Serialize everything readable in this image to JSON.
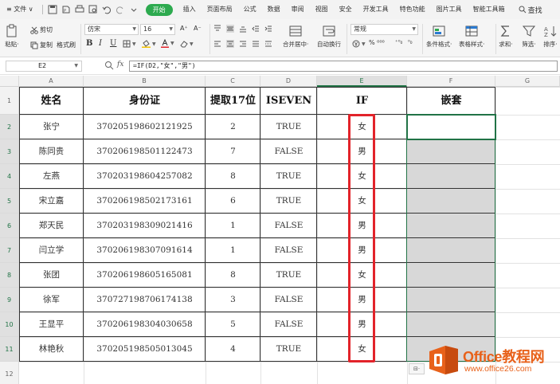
{
  "menubar": {
    "file_label": "≡ 文件 ∨",
    "tabs": [
      "插入",
      "页面布局",
      "公式",
      "数据",
      "审阅",
      "视图",
      "安全",
      "开发工具",
      "特色功能",
      "图片工具",
      "智能工具箱"
    ],
    "active_tab": "开始",
    "search_label": "查找"
  },
  "ribbon": {
    "paste_label": "粘贴·",
    "cut_label": "剪切",
    "copy_label": "复制",
    "format_painter_label": "格式刷",
    "font_name": "仿宋",
    "font_size": "16",
    "font_grow": "A⁺",
    "font_shrink": "A⁻",
    "bold": "B",
    "italic": "I",
    "underline": "U",
    "merge_center_label": "合并居中·",
    "wrap_text_label": "自动换行",
    "number_format": "常规",
    "percent_label": "% ⁰⁰⁰",
    "decimal_inc": "⁺⁰₀",
    "decimal_dec": "⁰₀",
    "cond_format_label": "条件格式·",
    "table_style_label": "表格样式·",
    "sum_label": "求和·",
    "filter_label": "筛选·",
    "sort_label": "排序·"
  },
  "formula_bar": {
    "cell_ref": "E2",
    "fx_label": "fx",
    "formula": "=IF(D2,\"女\",\"男\")"
  },
  "sheet": {
    "columns": [
      "A",
      "B",
      "C",
      "D",
      "E",
      "F",
      "G"
    ],
    "selected_column": "E",
    "row_numbers": [
      "1",
      "2",
      "3",
      "4",
      "5",
      "6",
      "7",
      "8",
      "9",
      "10",
      "11",
      "12"
    ],
    "headers": [
      "姓名",
      "身份证",
      "提取17位",
      "ISEVEN",
      "IF",
      "嵌套"
    ],
    "rows": [
      [
        "张宁",
        "370205198602121925",
        "2",
        "TRUE",
        "女",
        ""
      ],
      [
        "陈同贵",
        "370206198501122473",
        "7",
        "FALSE",
        "男",
        ""
      ],
      [
        "左燕",
        "370203198604257082",
        "8",
        "TRUE",
        "女",
        ""
      ],
      [
        "宋立嘉",
        "370206198502173161",
        "6",
        "TRUE",
        "女",
        ""
      ],
      [
        "郑天民",
        "370203198309021416",
        "1",
        "FALSE",
        "男",
        ""
      ],
      [
        "闫立学",
        "370206198307091614",
        "1",
        "FALSE",
        "男",
        ""
      ],
      [
        "张团",
        "370206198605165081",
        "8",
        "TRUE",
        "女",
        ""
      ],
      [
        "徐军",
        "370727198706174138",
        "3",
        "FALSE",
        "男",
        ""
      ],
      [
        "王显平",
        "370206198304030658",
        "5",
        "FALSE",
        "男",
        ""
      ],
      [
        "林艳秋",
        "370205198505013045",
        "4",
        "TRUE",
        "女",
        ""
      ]
    ],
    "paste_options_label": "⊟·"
  },
  "watermark": {
    "title": "Office教程网",
    "url": "www.office26.com"
  },
  "colors": {
    "accent_green": "#217346",
    "tab_start_green": "#2daa4f",
    "highlight_red": "#e2232a",
    "range_gray": "#d8d8d8",
    "watermark_orange": "#e8611a"
  }
}
